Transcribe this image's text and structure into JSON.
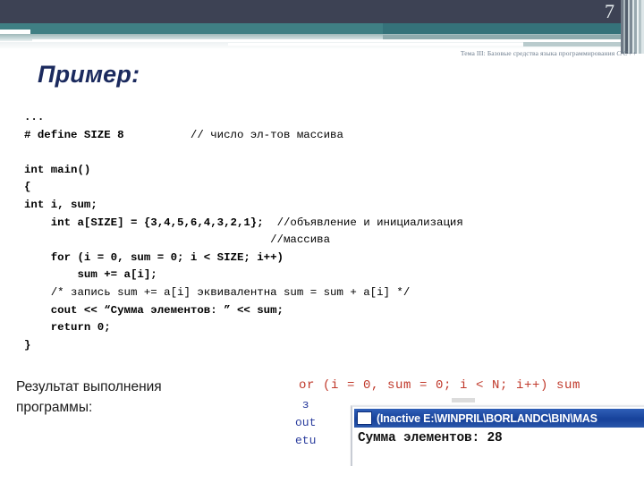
{
  "slide": {
    "page_number": "7",
    "subtitle_prefix": "Тема III: Базовые средства языка программирования ",
    "subtitle_italic": "C/C++",
    "title": "Пример:"
  },
  "code": {
    "lines": [
      {
        "text": "...",
        "bold": true
      },
      {
        "text": "# define SIZE 8          ",
        "bold": true,
        "comment": "// число эл-тов массива"
      },
      {
        "text": "",
        "bold": false
      },
      {
        "text": "int main()",
        "bold": true
      },
      {
        "text": "{",
        "bold": true
      },
      {
        "text": "int i, sum;",
        "bold": true
      },
      {
        "text": "    int a[SIZE] = {3,4,5,6,4,3,2,1};  ",
        "bold": true,
        "comment": "//объявление и инициализация"
      },
      {
        "text": "                                     ",
        "bold": true,
        "comment": "//массива"
      },
      {
        "text": "    for (i = 0, sum = 0; i < SIZE; i++)",
        "bold": true
      },
      {
        "text": "        sum += a[i];",
        "bold": true
      },
      {
        "text": "    ",
        "bold": true,
        "comment": "/* запись sum += a[i] эквивалентна sum = sum + a[i] */"
      },
      {
        "text": "    cout << “Сумма элементов: ” << sum;",
        "bold": true
      },
      {
        "text": "    return 0;",
        "bold": true
      },
      {
        "text": "}",
        "bold": true
      }
    ]
  },
  "result": {
    "caption_line1": "Результат выполнения",
    "caption_line2": "программы:",
    "screenshot": {
      "ide_code_red_1": "or (i = 0, ",
      "ide_code_red_2": "sum = 0; i < N; i++) sum",
      "ide_side_text": " з\nout\netu",
      "console_title": "(Inactive E:\\WINPRIL\\BORLANDC\\BIN\\MAS",
      "console_output": "Сумма элементов: 28",
      "icon": "window-icon"
    }
  },
  "colors": {
    "navy_band": "#3d4254",
    "teal_band": "#3f7f84",
    "title_color": "#1b2a5e",
    "subtitle_color": "#6b7b8c",
    "console_titlebar": "#17429a",
    "ide_red": "#c0392b",
    "ide_blue": "#2c3e9e"
  }
}
